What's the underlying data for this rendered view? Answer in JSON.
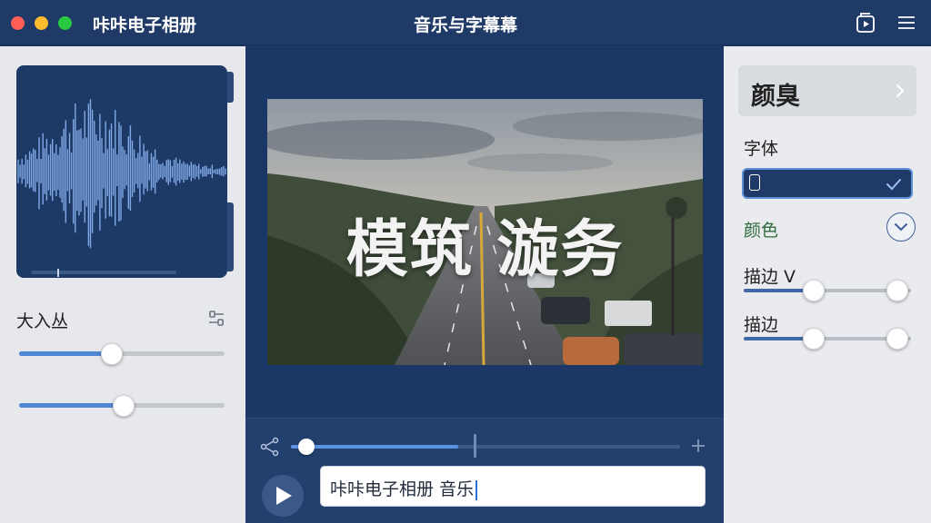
{
  "app": {
    "name": "咔咔电子相册",
    "window_title": "音乐与字幕幕"
  },
  "titlebar": {
    "icons": [
      "play-square-icon",
      "menu-icon"
    ]
  },
  "left_panel": {
    "label": "大入丛",
    "adjust_icon": "sliders-icon",
    "sliders": [
      {
        "level": 0.45
      },
      {
        "level": 0.51
      }
    ]
  },
  "preview": {
    "overlay_text": "模筑 漩务"
  },
  "timeline": {
    "progress": 0.43,
    "marker": 0.47
  },
  "input": {
    "value": "咔咔电子相册 音乐"
  },
  "right_panel": {
    "style_title": "颜臭",
    "font_label": "字体",
    "color_label": "颜色",
    "stroke_label": "描边 V",
    "stroke2_label": "描边",
    "sliders": [
      {
        "start": 0.42,
        "end": 0.92
      },
      {
        "start": 0.42,
        "end": 0.92
      }
    ]
  },
  "colors": {
    "accent": "#4f86d6",
    "navy": "#1d3a66",
    "green_label": "#2f6a3a"
  }
}
